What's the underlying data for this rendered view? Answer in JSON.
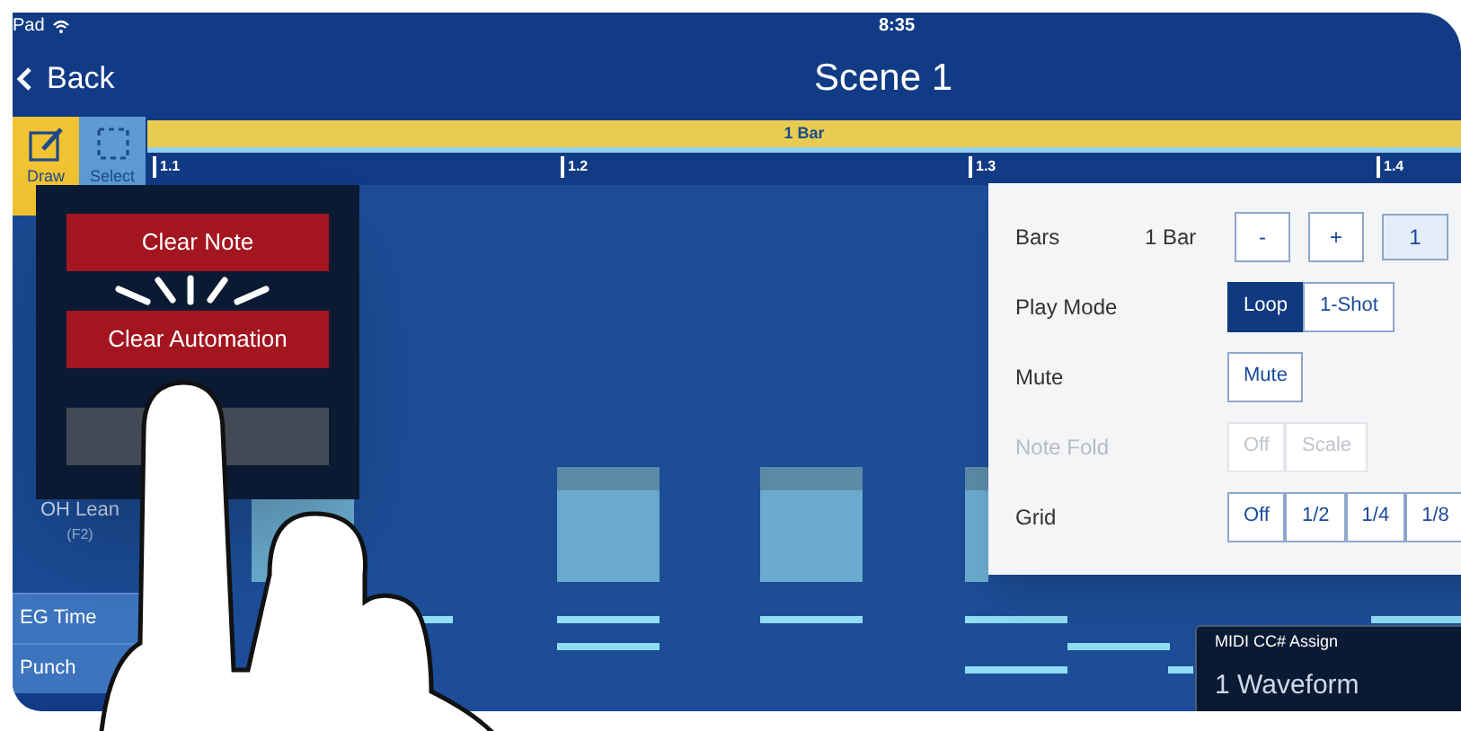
{
  "status_bar": {
    "carrier": "Pad",
    "time": "8:35"
  },
  "nav": {
    "back": "Back",
    "title": "Scene 1"
  },
  "tools": [
    {
      "label": "Draw",
      "kind": "draw",
      "selected": true
    },
    {
      "label": "Select",
      "kind": "select",
      "selected": false
    }
  ],
  "bar_header": {
    "label": "1 Bar"
  },
  "ruler": [
    "1.1",
    "1.2",
    "1.3",
    "1.4"
  ],
  "tracks": [
    {
      "name": "OH Lean",
      "sub": "(F2)"
    }
  ],
  "automation_lanes": [
    {
      "name": "EG Time"
    },
    {
      "name": "Punch"
    }
  ],
  "context_menu": {
    "buttons": [
      {
        "kind": "action",
        "label": "Clear Note"
      },
      {
        "kind": "action",
        "label": "Clear Automation"
      },
      {
        "kind": "blank"
      }
    ]
  },
  "settings_panel": {
    "rows": [
      {
        "label": "Bars",
        "kind": "stepper",
        "value": "1 Bar",
        "disabled": false,
        "steps": [
          "-",
          "+"
        ],
        "options": [
          {
            "label": "1",
            "selected": true
          }
        ]
      },
      {
        "label": "Play Mode",
        "kind": "segmented",
        "disabled": false,
        "options": [
          {
            "label": "Loop",
            "selected": true
          },
          {
            "label": "1-Shot",
            "selected": false
          }
        ]
      },
      {
        "label": "Mute",
        "kind": "toggle",
        "disabled": false,
        "options": [
          {
            "label": "Mute",
            "selected": false
          }
        ]
      },
      {
        "label": "Note Fold",
        "kind": "segmented",
        "disabled": true,
        "options": [
          {
            "label": "Off",
            "selected": false
          },
          {
            "label": "Scale",
            "selected": false
          }
        ]
      },
      {
        "label": "Grid",
        "kind": "segmented",
        "disabled": false,
        "options": [
          {
            "label": "Off",
            "selected": false
          },
          {
            "label": "1/2",
            "selected": false
          },
          {
            "label": "1/4",
            "selected": false
          },
          {
            "label": "1/8",
            "selected": false
          }
        ]
      }
    ]
  },
  "midi_overlay": {
    "label": "MIDI CC# Assign",
    "value": "1 Waveform"
  }
}
